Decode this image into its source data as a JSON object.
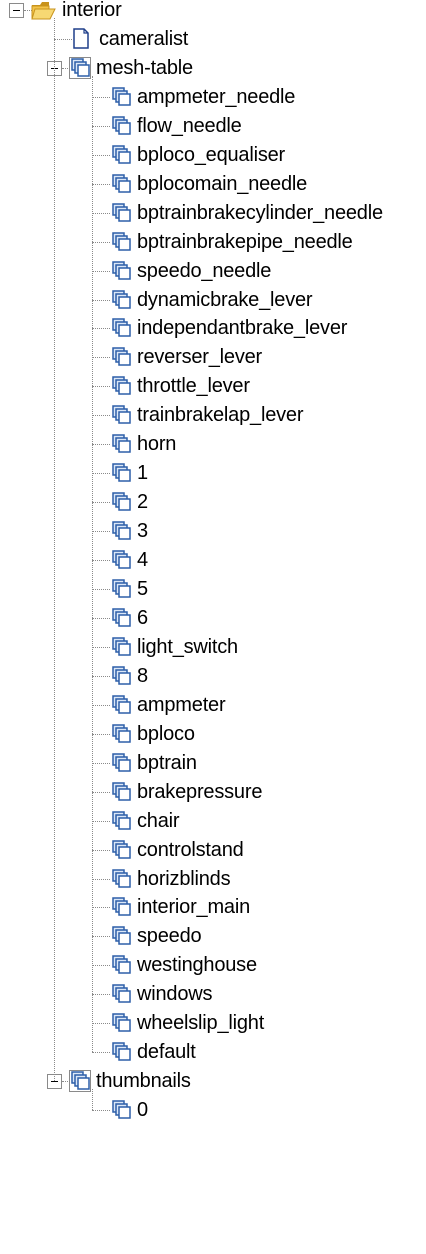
{
  "tree": {
    "root": {
      "label": "interior",
      "icon": "folder-icon",
      "expanded": true
    },
    "cameralist": {
      "label": "cameralist",
      "icon": "document-icon"
    },
    "mesh_table": {
      "label": "mesh-table",
      "icon": "mesh-group-icon",
      "expanded": true,
      "items": [
        "ampmeter_needle",
        "flow_needle",
        "bploco_equaliser",
        "bplocomain_needle",
        "bptrainbrakecylinder_needle",
        "bptrainbrakepipe_needle",
        "speedo_needle",
        "dynamicbrake_lever",
        "independantbrake_lever",
        "reverser_lever",
        "throttle_lever",
        "trainbrakelap_lever",
        "horn",
        "1",
        "2",
        "3",
        "4",
        "5",
        "6",
        "light_switch",
        "8",
        "ampmeter",
        "bploco",
        "bptrain",
        "brakepressure",
        "chair",
        "controlstand",
        "horizblinds",
        "interior_main",
        "speedo",
        "westinghouse",
        "windows",
        "wheelslip_light",
        "default"
      ]
    },
    "thumbnails": {
      "label": "thumbnails",
      "icon": "mesh-group-icon",
      "expanded": true,
      "items": [
        "0"
      ]
    }
  },
  "colors": {
    "folder_body": "#f3c44a",
    "folder_dark": "#c8931c",
    "mesh_blue": "#2d5fa8",
    "mesh_light": "#dbe7f7",
    "connector": "#8a8a8a"
  }
}
